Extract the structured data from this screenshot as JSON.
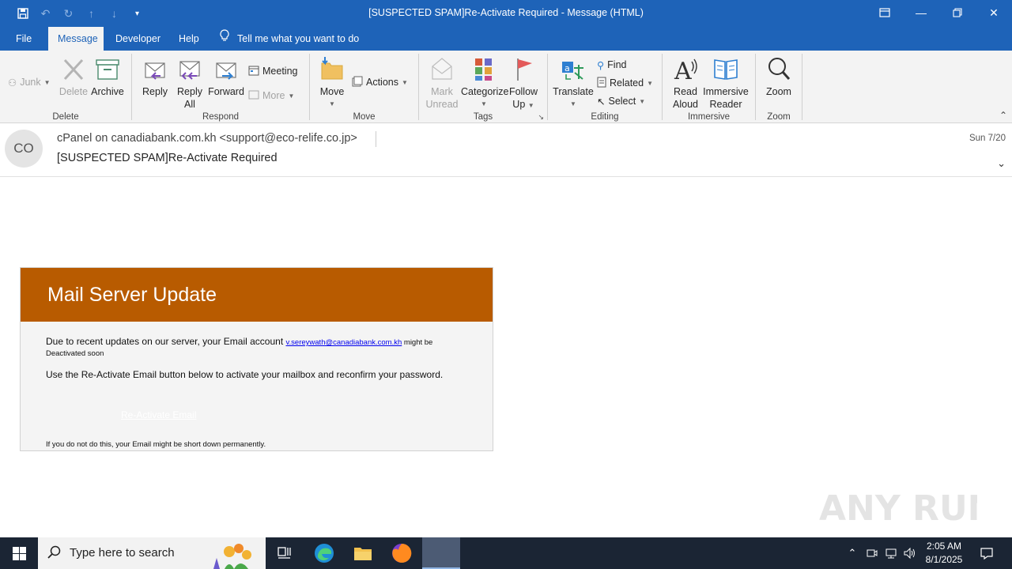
{
  "window": {
    "title": "[SUSPECTED SPAM]Re-Activate Required  -  Message (HTML)"
  },
  "tabs": [
    {
      "label": "File"
    },
    {
      "label": "Message"
    },
    {
      "label": "Developer"
    },
    {
      "label": "Help"
    }
  ],
  "tell_me": "Tell me what you want to do",
  "ribbon": {
    "delete_group": {
      "label": "Delete",
      "junk": "Junk",
      "delete": "Delete",
      "archive": "Archive"
    },
    "respond_group": {
      "label": "Respond",
      "reply": "Reply",
      "reply_all_1": "Reply",
      "reply_all_2": "All",
      "forward": "Forward",
      "meeting": "Meeting",
      "more": "More"
    },
    "move_group": {
      "label": "Move",
      "move": "Move",
      "actions": "Actions"
    },
    "tags_group": {
      "label": "Tags",
      "mark_unread_1": "Mark",
      "mark_unread_2": "Unread",
      "categorize": "Categorize",
      "follow_up_1": "Follow",
      "follow_up_2": "Up"
    },
    "editing_group": {
      "label": "Editing",
      "translate": "Translate",
      "find": "Find",
      "related": "Related",
      "select": "Select"
    },
    "immersive_group": {
      "label": "Immersive",
      "read_aloud_1": "Read",
      "read_aloud_2": "Aloud",
      "immersive_reader_1": "Immersive",
      "immersive_reader_2": "Reader"
    },
    "zoom_group": {
      "label": "Zoom",
      "zoom": "Zoom"
    }
  },
  "header": {
    "avatar_initials": "CO",
    "from": "cPanel on canadiabank.com.kh <support@eco-relife.co.jp>",
    "subject": "[SUSPECTED SPAM]Re-Activate Required",
    "date": "Sun 7/20"
  },
  "message": {
    "heading": "Mail Server Update",
    "p1_start": "Due to recent updates on our server, your Email account ",
    "p1_link": "v.sereywath@canadiabank.com.kh",
    "p1_end_a": " might be",
    "p1_end_b": "Deactivated soon",
    "p2": "Use the Re-Activate Email button below to activate your mailbox and reconfirm your password.",
    "button_link": "Re-Activate Email",
    "p3": "If you do not do this, your Email might be short down permanently."
  },
  "watermark": "ANY RUN",
  "taskbar": {
    "search_placeholder": "Type here to search",
    "time": "2:05 AM",
    "date": "8/1/2025"
  },
  "colors": {
    "accent_blue": "#1e63b8",
    "mail_header_orange": "#b85b00",
    "taskbar": "#1b2534"
  }
}
